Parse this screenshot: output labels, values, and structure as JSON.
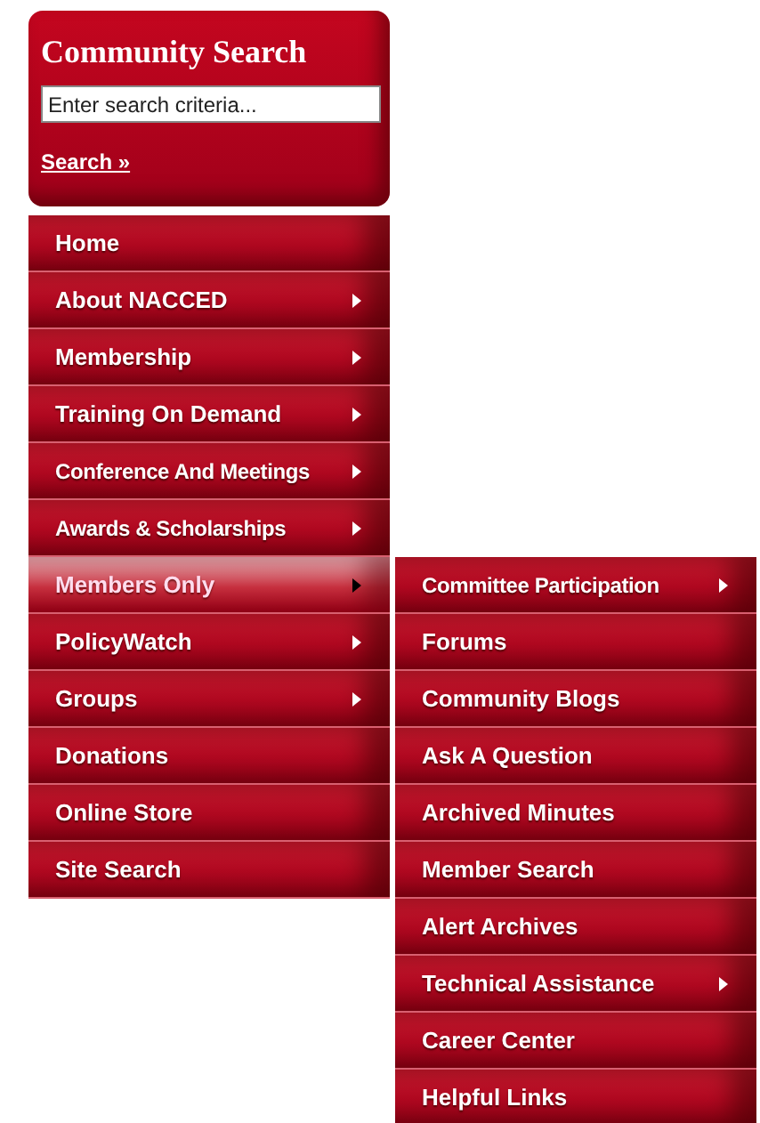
{
  "search": {
    "title": "Community Search",
    "placeholder": "Enter search criteria...",
    "link": "Search »"
  },
  "menu": [
    {
      "label": "Home",
      "has_submenu": false,
      "selected": false
    },
    {
      "label": "About NACCED",
      "has_submenu": true,
      "selected": false
    },
    {
      "label": "Membership",
      "has_submenu": true,
      "selected": false
    },
    {
      "label": "Training On Demand",
      "has_submenu": true,
      "selected": false
    },
    {
      "label": "Conference And Meetings",
      "has_submenu": true,
      "selected": false
    },
    {
      "label": "Awards & Scholarships",
      "has_submenu": true,
      "selected": false
    },
    {
      "label": "Members Only",
      "has_submenu": true,
      "selected": true,
      "submenu": [
        {
          "label": "Committee Participation",
          "has_submenu": true
        },
        {
          "label": "Forums",
          "has_submenu": false
        },
        {
          "label": "Community Blogs",
          "has_submenu": false
        },
        {
          "label": "Ask A Question",
          "has_submenu": false
        },
        {
          "label": "Archived Minutes",
          "has_submenu": false
        },
        {
          "label": "Member Search",
          "has_submenu": false
        },
        {
          "label": "Alert Archives",
          "has_submenu": false
        },
        {
          "label": "Technical Assistance",
          "has_submenu": true
        },
        {
          "label": "Career Center",
          "has_submenu": false
        },
        {
          "label": "Helpful Links",
          "has_submenu": false
        }
      ]
    },
    {
      "label": "PolicyWatch",
      "has_submenu": true,
      "selected": false
    },
    {
      "label": "Groups",
      "has_submenu": true,
      "selected": false
    },
    {
      "label": "Donations",
      "has_submenu": false,
      "selected": false
    },
    {
      "label": "Online Store",
      "has_submenu": false,
      "selected": false
    },
    {
      "label": "Site Search",
      "has_submenu": false,
      "selected": false
    }
  ]
}
